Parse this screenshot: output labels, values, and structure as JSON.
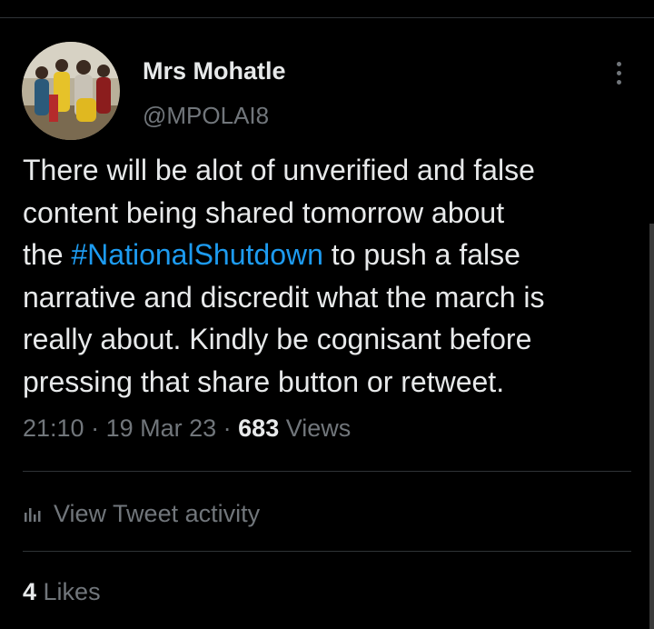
{
  "author": {
    "display_name": "Mrs Mohatle",
    "handle": "@MPOLAI8",
    "avatar_icon": "profile-photo-group"
  },
  "tweet": {
    "line1": "There will be alot of unverified and false",
    "line2": "content being shared tomorrow about",
    "line3_before": "the ",
    "hashtag": "#NationalShutdown",
    "line3_after": " to push a false",
    "line4": "narrative and discredit what the march is",
    "line5": "really about. Kindly be cognisant before",
    "line6": "pressing that share button or retweet."
  },
  "meta": {
    "time": "21:10",
    "separator": " · ",
    "date": "19 Mar 23",
    "views_count": "683",
    "views_label": " Views"
  },
  "activity": {
    "label": "View Tweet activity",
    "icon": "bar-chart-icon"
  },
  "likes": {
    "count": "4",
    "label": " Likes"
  },
  "colors": {
    "background": "#000000",
    "text_primary": "#e7e9ea",
    "text_secondary": "#71767b",
    "link": "#1d9bf0",
    "divider": "#2f3336"
  }
}
